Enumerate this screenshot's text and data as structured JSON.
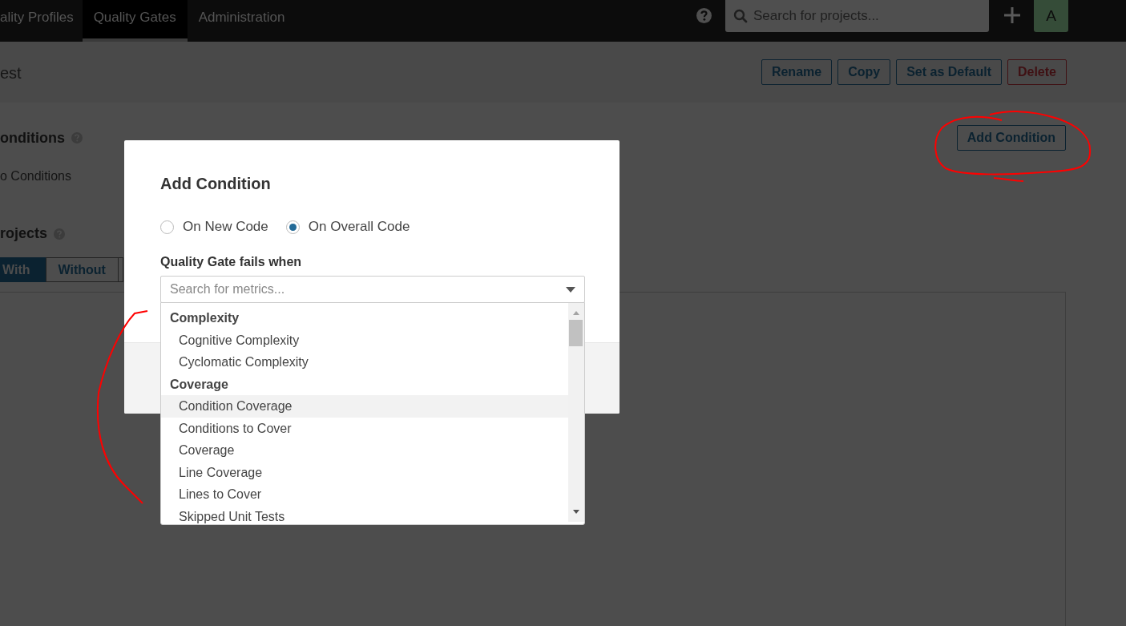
{
  "nav": {
    "items": [
      {
        "label": "ality Profiles",
        "selected": false
      },
      {
        "label": "Quality Gates",
        "selected": true
      },
      {
        "label": "Administration",
        "selected": false
      }
    ],
    "search": {
      "placeholder": "Search for projects..."
    },
    "avatar": "A"
  },
  "page": {
    "title": "est",
    "actions": [
      {
        "label": "Rename",
        "kind": "default"
      },
      {
        "label": "Copy",
        "kind": "default"
      },
      {
        "label": "Set as Default",
        "kind": "default"
      },
      {
        "label": "Delete",
        "kind": "danger"
      }
    ],
    "conditions": {
      "heading": "onditions",
      "empty_text": "o Conditions",
      "add_button": "Add Condition"
    },
    "projects": {
      "heading": "rojects",
      "tabs": [
        {
          "label": "With",
          "selected": true
        },
        {
          "label": "Without",
          "selected": false
        }
      ]
    }
  },
  "modal": {
    "title": "Add Condition",
    "scope_options": [
      {
        "label": "On New Code",
        "selected": false
      },
      {
        "label": "On Overall Code",
        "selected": true
      }
    ],
    "field_label": "Quality Gate fails when",
    "metric_search": {
      "placeholder": "Search for metrics..."
    },
    "metric_groups": [
      {
        "name": "Complexity",
        "items": [
          {
            "label": "Cognitive Complexity",
            "highlighted": false
          },
          {
            "label": "Cyclomatic Complexity",
            "highlighted": false
          }
        ]
      },
      {
        "name": "Coverage",
        "items": [
          {
            "label": "Condition Coverage",
            "highlighted": true
          },
          {
            "label": "Conditions to Cover",
            "highlighted": false
          },
          {
            "label": "Coverage",
            "highlighted": false
          },
          {
            "label": "Line Coverage",
            "highlighted": false
          },
          {
            "label": "Lines to Cover",
            "highlighted": false
          },
          {
            "label": "Skipped Unit Tests",
            "highlighted": false
          }
        ]
      }
    ]
  }
}
